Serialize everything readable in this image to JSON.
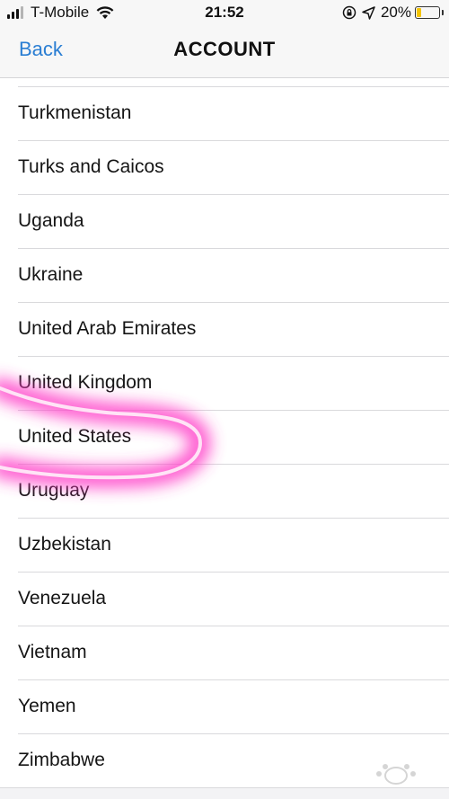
{
  "status_bar": {
    "carrier": "T-Mobile",
    "time": "21:52",
    "battery_percent": "20%",
    "battery_level": 0.2,
    "icons": [
      "signal-icon",
      "wifi-icon",
      "rotation-lock-icon",
      "location-arrow-icon",
      "battery-icon"
    ]
  },
  "nav": {
    "back_label": "Back",
    "title": "ACCOUNT"
  },
  "countries": [
    "Turkmenistan",
    "Turks and Caicos",
    "Uganda",
    "Ukraine",
    "United Arab Emirates",
    "United Kingdom",
    "United States",
    "Uruguay",
    "Uzbekistan",
    "Venezuela",
    "Vietnam",
    "Yemen",
    "Zimbabwe"
  ],
  "highlighted_country": "United States",
  "colors": {
    "accent": "#2a7ed3",
    "highlight": "#ff3cc8",
    "battery": "#f4c400"
  }
}
